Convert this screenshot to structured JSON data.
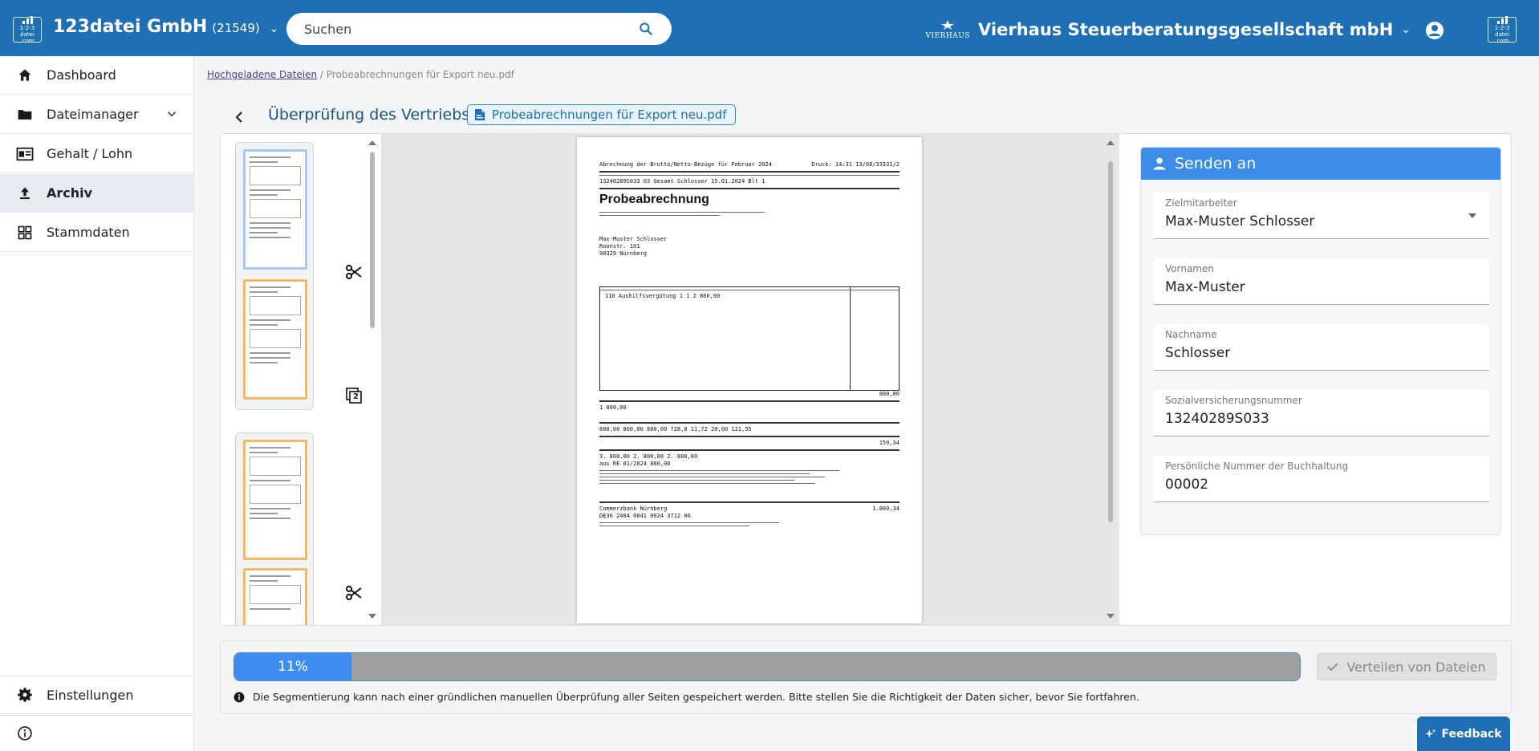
{
  "header": {
    "logo_text_1": "1-2-3",
    "logo_text_2": "datei",
    "logo_text_3": ".com",
    "company_name": "123datei GmbH",
    "company_id": "(21549)",
    "search_placeholder": "Suchen",
    "tenant_logo_text": "VIERHAUS",
    "tenant_name": "Vierhaus Steuerberatungsgesellschaft mbH"
  },
  "sidebar": {
    "items": [
      {
        "label": "Dashboard",
        "icon": "home-icon"
      },
      {
        "label": "Dateimanager",
        "icon": "folder-icon"
      },
      {
        "label": "Gehalt / Lohn",
        "icon": "payslip-icon"
      },
      {
        "label": "Archiv",
        "icon": "upload-icon"
      },
      {
        "label": "Stammdaten",
        "icon": "grid-icon"
      }
    ],
    "settings_label": "Einstellungen",
    "info_icon": "info-icon"
  },
  "breadcrumb": {
    "link": "Hochgeladene Dateien",
    "separator": "/",
    "current": "Probeabrechnungen für Export neu.pdf"
  },
  "page": {
    "title": "Überprüfung des Vertriebs",
    "file_chip": "Probeabrechnungen für Export neu.pdf"
  },
  "document": {
    "line1": "Abrechnung der Brutto/Netto-Bezüge   für Februar 2024",
    "line1b": "Druck: 14:31  13/08/33331/2",
    "line2": "13240289S033  03 Gesamt Schlosser   15.01.2024   Blt 1",
    "heading": "Probeabrechnung",
    "addr1": "Max-Muster Schlosser",
    "addr2": "Roonstr. 101",
    "addr3": "90329 Nürnberg",
    "row1": "110  Aushilfsvergütung   1  1  2      800,00",
    "sum1": "800,00",
    "row2": "1     800,00",
    "row3": "800,00  800,00  800,00   728,8  11,72  20,00   121,55",
    "val1": "159,34",
    "val2": "3. 800,00    2. 800,00    2. 800,00",
    "val3": "aus RE 01/2024      800,00",
    "bank": "Commerzbank Nürnberg",
    "iban": "DE36 2404 0041 0024 3712 06",
    "total": "1.800,34"
  },
  "send_card": {
    "title": "Senden an",
    "fields": [
      {
        "label": "Zielmitarbeiter",
        "value": "Max-Muster Schlosser"
      },
      {
        "label": "Vornamen",
        "value": "Max-Muster"
      },
      {
        "label": "Nachname",
        "value": "Schlosser"
      },
      {
        "label": "Sozialversicherungsnummer",
        "value": "13240289S033"
      },
      {
        "label": "Persönliche Nummer der Buchhaltung",
        "value": "00002"
      }
    ]
  },
  "progress": {
    "percent_label": "11%",
    "value": 0.11
  },
  "distribute_button": "Verteilen von Dateien",
  "note": "Die Segmentierung kann nach einer gründlichen manuellen Überprüfung aller Seiten gespeichert werden. Bitte stellen Sie die Richtigkeit der Daten sicher, bevor Sie fortfahren.",
  "thumb_badge": "2",
  "feedback_label": "Feedback",
  "colors": {
    "primary": "#1f6fb5",
    "accent": "#3d8ce8",
    "selected_thumb": "#a9c7f0",
    "normal_thumb": "#f3b863"
  }
}
